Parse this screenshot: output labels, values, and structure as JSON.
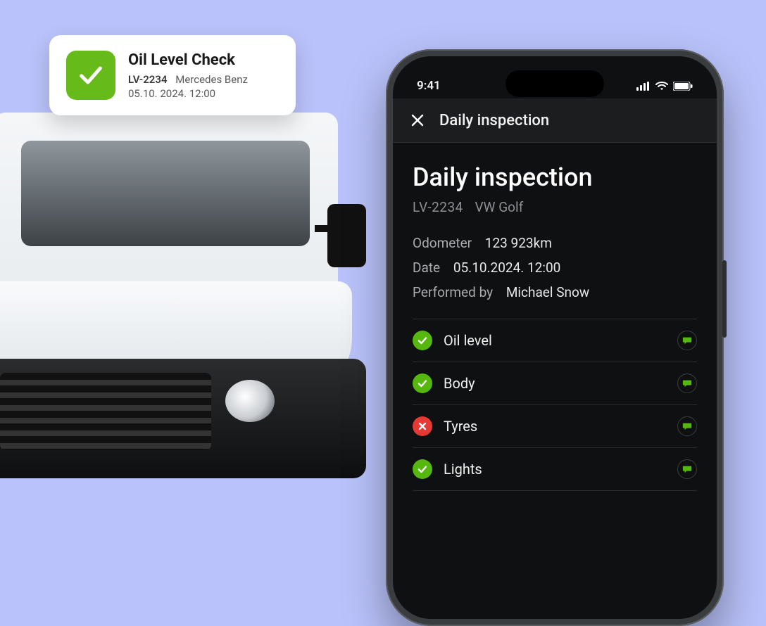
{
  "card": {
    "title": "Oil Level Check",
    "plate": "LV-2234",
    "vehicle": "Mercedes Benz",
    "datetime": "05.10. 2024. 12:00"
  },
  "statusbar": {
    "time": "9:41"
  },
  "app": {
    "header_title": "Daily inspection",
    "page_title": "Daily inspection",
    "plate": "LV-2234",
    "vehicle": "VW Golf",
    "meta": {
      "odometer_label": "Odometer",
      "odometer_value": "123 923km",
      "date_label": "Date",
      "date_value": "05.10.2024. 12:00",
      "performed_label": "Performed by",
      "performed_value": "Michael Snow"
    },
    "checks": [
      {
        "label": "Oil level",
        "status": "pass"
      },
      {
        "label": "Body",
        "status": "pass"
      },
      {
        "label": "Tyres",
        "status": "fail"
      },
      {
        "label": "Lights",
        "status": "pass"
      }
    ]
  }
}
